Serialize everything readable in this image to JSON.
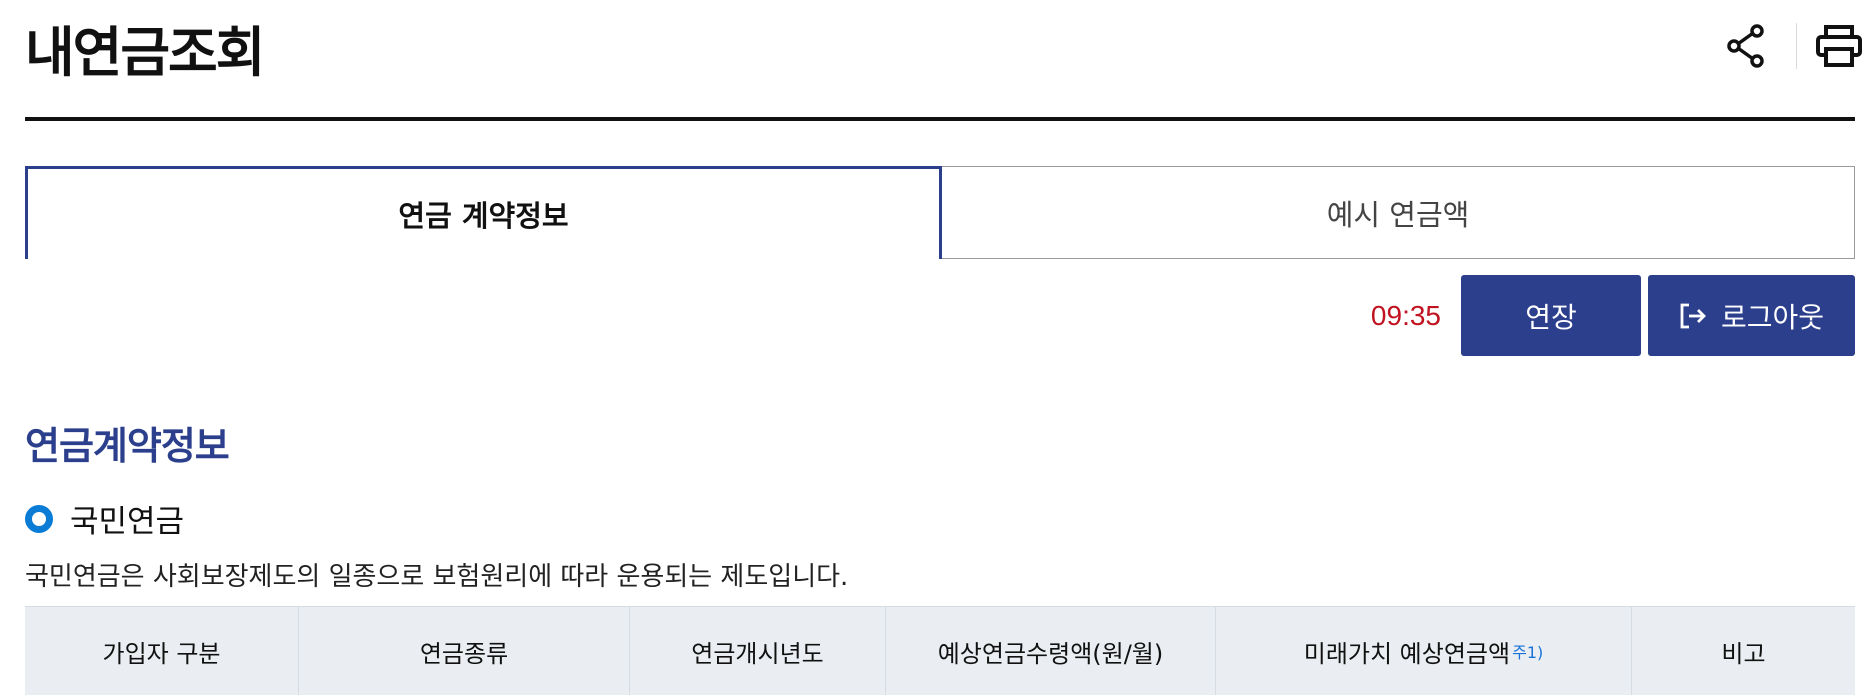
{
  "page": {
    "title": "내연금조회"
  },
  "header_tools": {
    "share_icon": "share-icon",
    "print_icon": "printer-icon"
  },
  "tabs": [
    {
      "label": "연금 계약정보",
      "active": true
    },
    {
      "label": "예시 연금액",
      "active": false
    }
  ],
  "session": {
    "timer": "09:35",
    "extend_label": "연장",
    "logout_label": "로그아웃",
    "logout_icon": "logout-icon"
  },
  "section": {
    "title": "연금계약정보",
    "subheading": "국민연금",
    "description": "국민연금은 사회보장제도의 일종으로 보험원리에 따라 운용되는 제도입니다."
  },
  "table": {
    "headers": [
      {
        "label": "가입자 구분"
      },
      {
        "label": "연금종류"
      },
      {
        "label": "연금개시년도"
      },
      {
        "label": "예상연금수령액(원/월)"
      },
      {
        "label": "미래가치 예상연금액",
        "note": "주1)"
      },
      {
        "label": "비고"
      }
    ]
  },
  "colors": {
    "primary": "#2b3f8c",
    "timer": "#c1121f",
    "bullet": "#0a7cd6",
    "note": "#1a73d9",
    "table_header_bg": "#eaeef2"
  }
}
